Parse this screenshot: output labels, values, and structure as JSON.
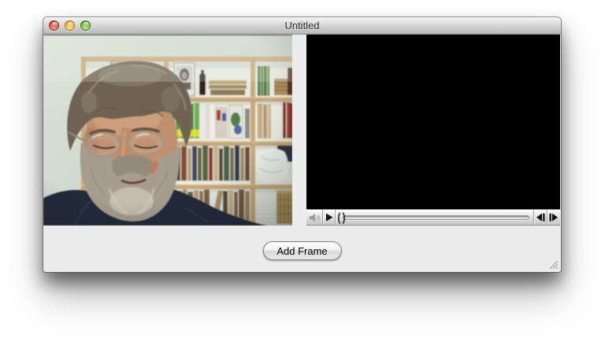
{
  "window": {
    "title": "Untitled"
  },
  "titlebar": {
    "buttons": [
      {
        "name": "close",
        "color": "#d84a3c"
      },
      {
        "name": "minimize",
        "color": "#eda93a"
      },
      {
        "name": "zoom",
        "color": "#69ae34"
      }
    ]
  },
  "panes": {
    "camera_preview": {
      "description": "live camera preview: man with wire-rim glasses and gray beard, navy shirt, in front of wooden bookshelves"
    },
    "movie_view": {
      "state": "empty",
      "background": "#000000"
    }
  },
  "movie_controller": {
    "icons": [
      "volume-icon",
      "play-icon",
      "playhead",
      "step-backward-icon",
      "step-forward-icon"
    ],
    "volume_enabled": false,
    "playhead_position": 0
  },
  "footer": {
    "add_frame_label": "Add Frame"
  },
  "colors": {
    "window_bg": "#ececec",
    "titlebar_text": "#2e2e2e",
    "shirt_navy": "#202a3a",
    "shelf_wood": "#c9a878"
  }
}
